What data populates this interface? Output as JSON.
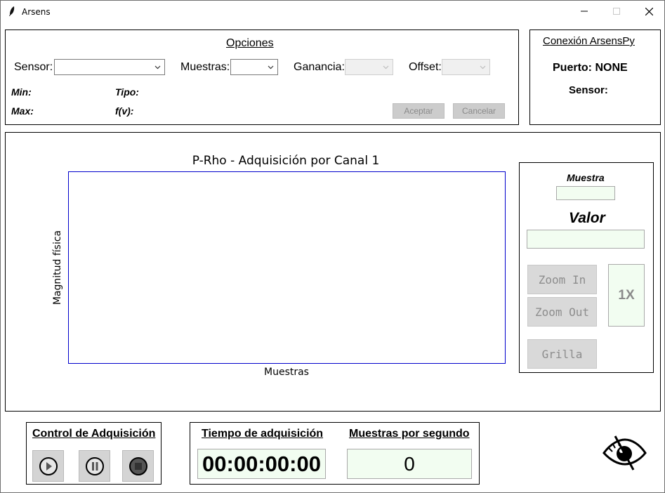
{
  "window": {
    "title": "Arsens"
  },
  "opciones": {
    "heading": "Opciones",
    "sensor_label": "Sensor:",
    "sensor_value": "",
    "muestras_label": "Muestras:",
    "muestras_value": "",
    "ganancia_label": "Ganancia:",
    "ganancia_value": "",
    "offset_label": "Offset:",
    "offset_value": "",
    "min_label": "Min:",
    "max_label": "Max:",
    "tipo_label": "Tipo:",
    "fv_label": "f(v):",
    "aceptar_label": "Aceptar",
    "cancelar_label": "Cancelar"
  },
  "conexion": {
    "heading": "Conexión ArsensPy",
    "puerto_text": "Puerto: NONE",
    "sensor_text": "Sensor:"
  },
  "plot": {
    "chart_data": {
      "type": "line",
      "title": "P-Rho - Adquisición por Canal 1",
      "xlabel": "Muestras",
      "ylabel": "Magnitud física",
      "series": [],
      "frame_color": "#0000cc"
    }
  },
  "side": {
    "muestra_label": "Muestra",
    "muestra_value": "",
    "valor_label": "Valor",
    "valor_value": "",
    "zoom_in_label": "Zoom In",
    "zoom_out_label": "Zoom Out",
    "zoom_level": "1X",
    "grilla_label": "Grilla"
  },
  "control": {
    "heading": "Control de Adquisición",
    "buttons": [
      {
        "icon": "play-icon"
      },
      {
        "icon": "pause-icon"
      },
      {
        "icon": "stop-icon"
      }
    ]
  },
  "tiempo": {
    "heading": "Tiempo de adquisición",
    "value": "00:00:00:00"
  },
  "mps": {
    "heading": "Muestras por segundo",
    "value": "0"
  },
  "visibility": {
    "icon": "eye-hidden-icon"
  }
}
